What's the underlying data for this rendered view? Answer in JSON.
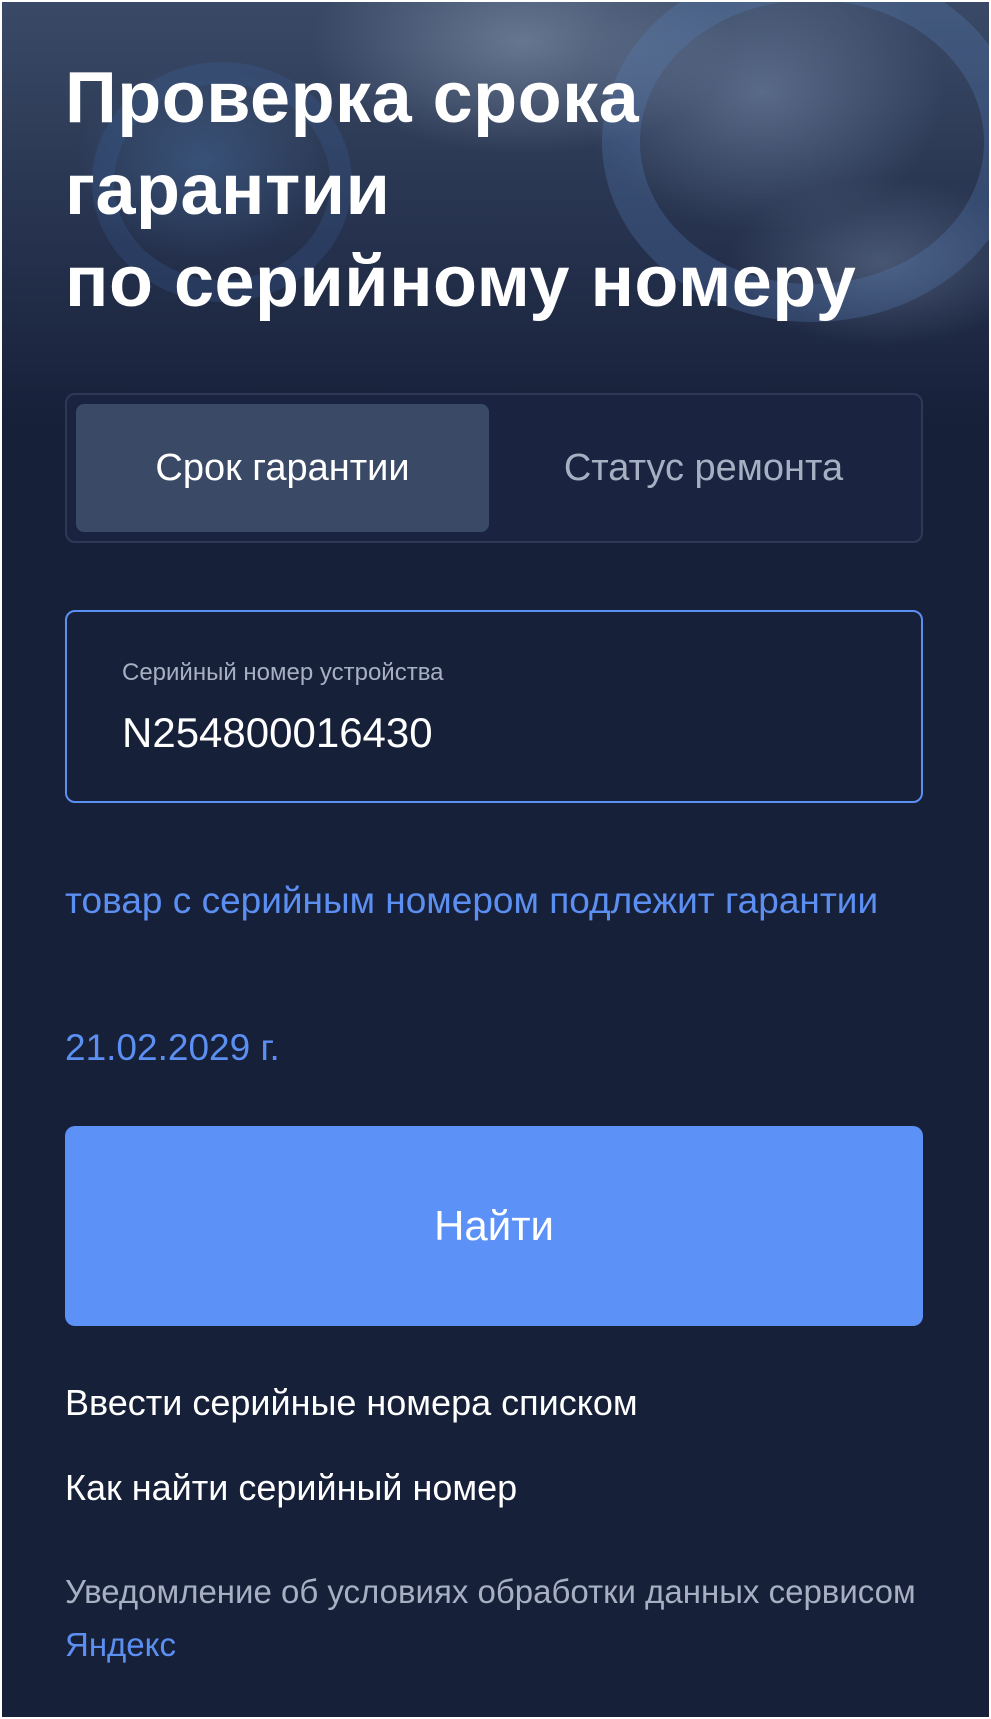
{
  "header": {
    "title_lines": [
      "Проверка срока",
      "гарантии",
      "по серийному номеру"
    ]
  },
  "tabs": [
    {
      "label": "Срок гарантии",
      "active": true
    },
    {
      "label": "Статус ремонта",
      "active": false
    }
  ],
  "serial_field": {
    "label": "Серийный номер устройства",
    "value": "N254800016430"
  },
  "result": {
    "message": "товар с серийным номером подлежит гарантии",
    "date": "21.02.2029 г."
  },
  "search_button": {
    "label": "Найти"
  },
  "links": {
    "bulk_entry": "Ввести серийные номера списком",
    "how_to_find": "Как найти серийный номер"
  },
  "notice": {
    "text": "Уведомление об условиях обработки данных сервисом",
    "link": "Яндекс"
  },
  "colors": {
    "background": "#172039",
    "accent": "#5c8ff2",
    "button": "#5c91f8",
    "tab_active": "#3a4966"
  }
}
